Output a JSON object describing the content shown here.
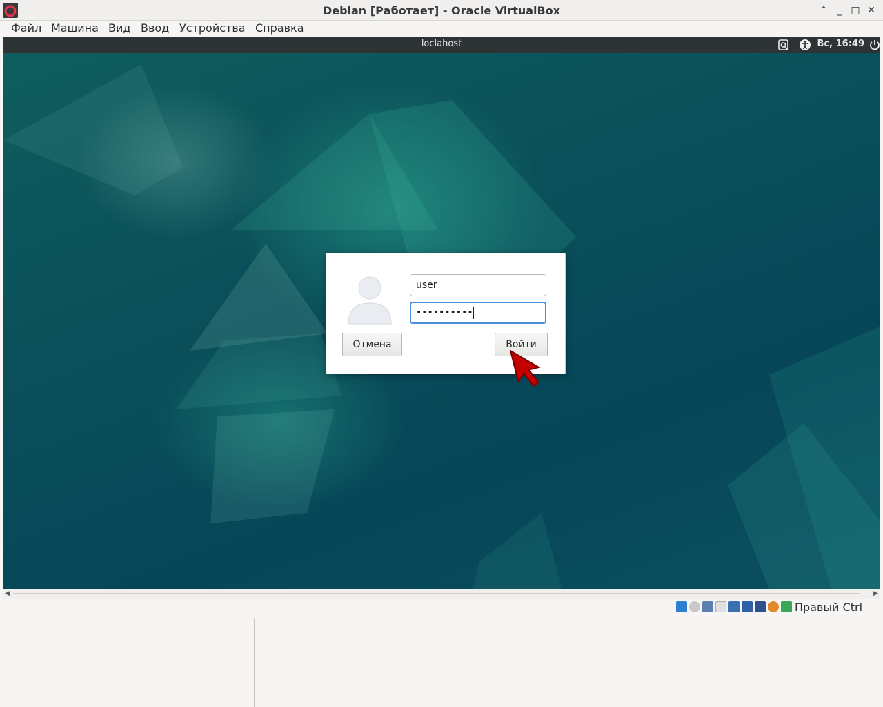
{
  "window": {
    "title": "Debian [Работает] - Oracle VirtualBox",
    "controls": {
      "collapse": "⌃",
      "minimize": "_",
      "maximize": "□",
      "close": "✕"
    }
  },
  "menubar": {
    "items": [
      {
        "label": "Файл"
      },
      {
        "label": "Машина"
      },
      {
        "label": "Вид"
      },
      {
        "label": "Ввод"
      },
      {
        "label": "Устройства"
      },
      {
        "label": "Справка"
      }
    ]
  },
  "guest": {
    "topbar": {
      "hostname": "loclahost",
      "clock": "Вс, 16:49",
      "icons": [
        "keyboard-layout-icon",
        "accessibility-icon",
        "power-icon"
      ]
    },
    "login": {
      "username": "user",
      "password_mask": "••••••••••",
      "cancel_label": "Отмена",
      "login_label": "Войти"
    }
  },
  "statusbar": {
    "icons": [
      "hard-disk-icon",
      "optical-drive-icon",
      "audio-icon",
      "shared-folders-icon",
      "display-icon",
      "network-icon",
      "usb-icon",
      "recording-icon",
      "cpu-icon",
      "mouse-integration-icon"
    ],
    "host_key": "Правый Ctrl"
  },
  "colors": {
    "accent": "#4a90d9",
    "guest_topbar": "#2e3436",
    "wallpaper": "#0a4f5a"
  }
}
